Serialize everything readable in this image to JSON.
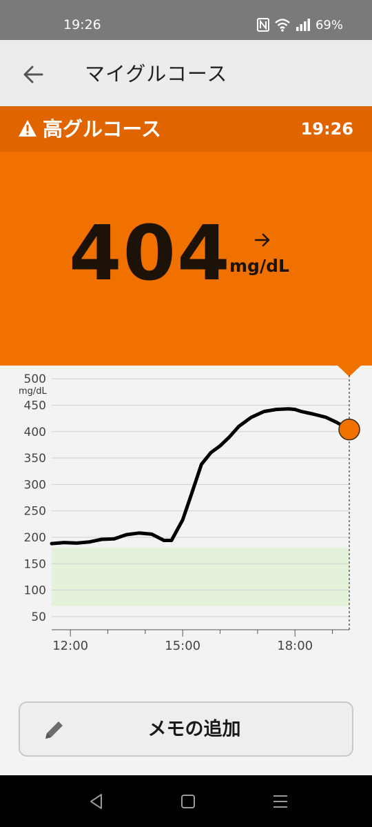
{
  "status_bar": {
    "time": "19:26",
    "battery": "69%",
    "icons": [
      "nfc-icon",
      "wifi-icon",
      "signal-icon"
    ]
  },
  "app_bar": {
    "title": "マイグルコース",
    "back_icon": "arrow-left-icon"
  },
  "alert": {
    "title": "高グルコース",
    "time": "19:26",
    "icon": "warning-icon",
    "color": "#e06400"
  },
  "reading": {
    "value": "404",
    "unit": "mg/dL",
    "trend_icon": "arrow-right-icon",
    "color": "#f07000"
  },
  "chart_data": {
    "type": "line",
    "ylabel": "mg/dL",
    "yticks": [
      500,
      450,
      400,
      350,
      300,
      250,
      200,
      150,
      100,
      50
    ],
    "ylim": [
      25,
      525
    ],
    "xticks": [
      {
        "label": "12:00",
        "t": 12.0
      },
      {
        "label": "15:00",
        "t": 15.0
      },
      {
        "label": "18:00",
        "t": 18.0
      }
    ],
    "xlim": [
      11.5,
      19.45
    ],
    "target_range": [
      70,
      180
    ],
    "grid": true,
    "series": [
      {
        "x": [
          11.5,
          11.83,
          12.17,
          12.5,
          12.83,
          13.17,
          13.5,
          13.83,
          14.17,
          14.5,
          14.7,
          15.0,
          15.25,
          15.5,
          15.75,
          16.0,
          16.25,
          16.5,
          16.83,
          17.17,
          17.5,
          17.83,
          18.0,
          18.17,
          18.5,
          18.83,
          19.1,
          19.45
        ],
        "y": [
          188,
          190,
          189,
          191,
          196,
          197,
          205,
          208,
          206,
          194,
          194,
          233,
          285,
          338,
          360,
          373,
          390,
          410,
          427,
          438,
          442,
          443,
          442,
          438,
          433,
          427,
          418,
          404
        ]
      }
    ],
    "current_point": {
      "t": 19.45,
      "value": 404
    },
    "colors": {
      "line": "#000000",
      "target": "#e5f2da",
      "marker": "#f07000"
    }
  },
  "memo_button": {
    "label": "メモの追加",
    "icon": "pencil-icon"
  },
  "nav_bar": {
    "buttons": [
      "back-triangle-icon",
      "home-square-icon",
      "recents-menu-icon"
    ]
  }
}
